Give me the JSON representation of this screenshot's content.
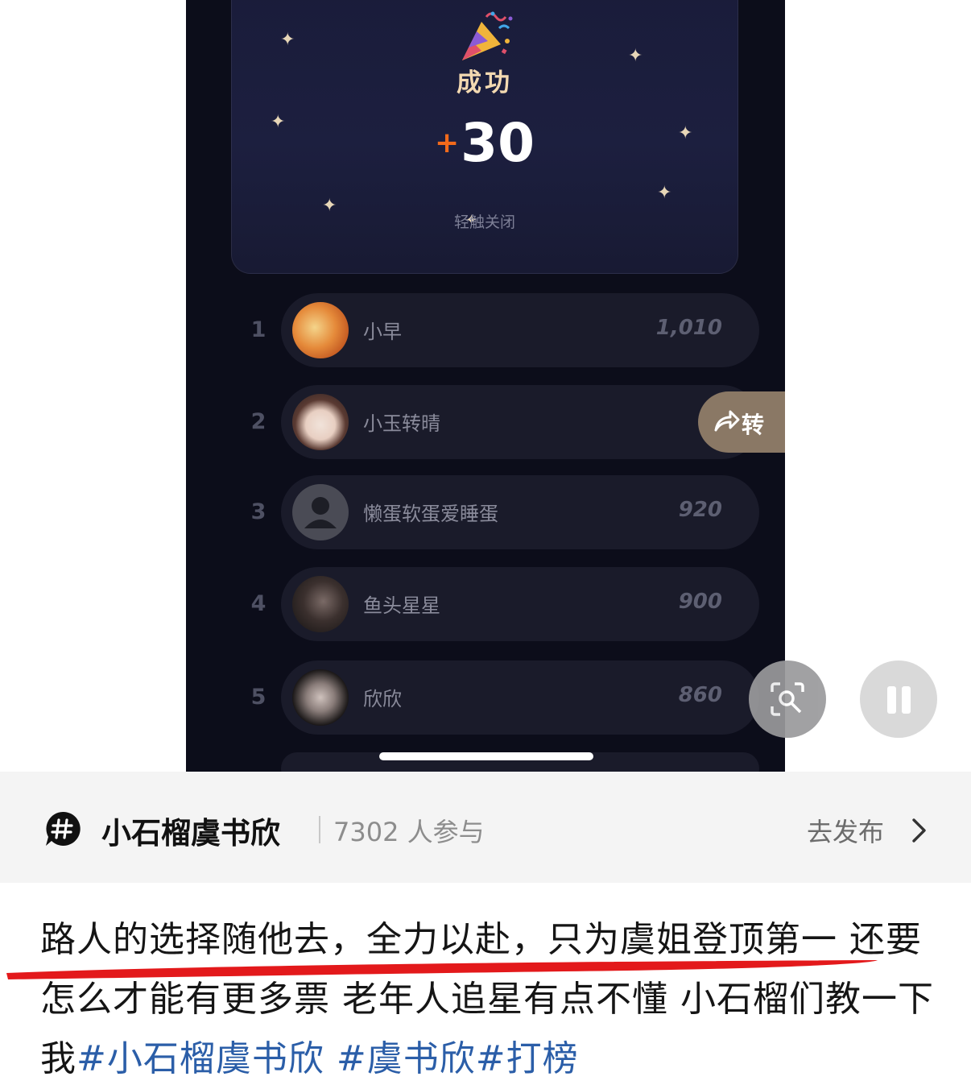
{
  "popup": {
    "title": "成功",
    "points_sign": "+",
    "points": "30",
    "close_hint": "轻触关闭"
  },
  "leaderboard": [
    {
      "rank": "1",
      "name": "小早",
      "score": "1,010"
    },
    {
      "rank": "2",
      "name": "小玉转晴",
      "score": "9"
    },
    {
      "rank": "3",
      "name": "懒蛋软蛋爱睡蛋",
      "score": "920"
    },
    {
      "rank": "4",
      "name": "鱼头星星",
      "score": "900"
    },
    {
      "rank": "5",
      "name": "欣欣",
      "score": "860"
    }
  ],
  "overlay": {
    "share_label": "转",
    "share_icon": "share-icon",
    "lens_icon": "lens-search-icon",
    "pause_icon": "pause-icon"
  },
  "topic": {
    "icon": "hashtag-icon",
    "name": "小石榴虞书欣",
    "participants": "7302 人参与",
    "publish_label": "去发布",
    "chevron": "chevron-right-icon"
  },
  "post": {
    "text": "路人的选择随他去，全力以赴，只为虞姐登顶第一 还要怎么才能有更多票 老年人追星有点不懂 小石榴们教一下我",
    "hashtags": [
      "#小石榴虞书欣",
      "#虞书欣",
      "#打榜"
    ]
  },
  "colors": {
    "points_plus": "#f26a1b",
    "hashtag": "#2b5ea8",
    "underline": "#e3191b"
  }
}
